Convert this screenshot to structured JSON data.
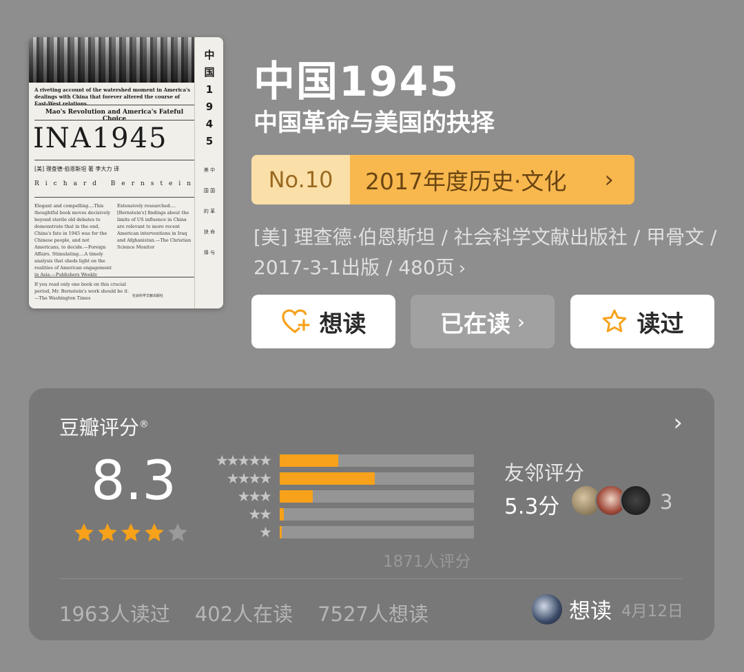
{
  "cover": {
    "side_title": "中\n国\n1\n9\n4\n5",
    "side_small": "美 中\n国 国\n的 革\n抉 命\n择 与",
    "tagline": "A riveting account of the watershed moment in America's dealings with China that forever altered the course of East-West relations.",
    "subtitle": "Mao's Revolution and America's Fateful Choice",
    "big_title": "INA1945",
    "credit": "[美] 理查德·伯恩斯坦 著    李大力 译",
    "author": "Richard Bernstein",
    "quote_left": "Elegant and compelling....This thoughtful book moves decisively beyond sterile old debates to demonstrate that in the end, China's fate in 1945 was for the Chinese people, and not Americans, to decide.—Foreign Affairs. Stimulating....A timely analysis that sheds light on the realities of American engagement in Asia.—Publishers Weekly",
    "quote_right": "Extensively researched....[Bernstein's] findings about the limits of US influence in China are relevant to more recent American interventions in Iraq and Afghanistan.—The Christian Science Monitor",
    "quote_bottom": "If you read only one book on this crucial period, Mr. Bernstein's work should be it.—The Washington Times",
    "publisher": "社会科学文献出版社"
  },
  "book": {
    "title": "中国1945",
    "subtitle": "中国革命与美国的抉择",
    "meta": "[美] 理查德·伯恩斯坦 / 社会科学文献出版社 / 甲骨文 / 2017-3-1出版 / 480页"
  },
  "rank": {
    "number": "No.10",
    "list_name": "2017年度历史·文化"
  },
  "actions": {
    "want": "想读",
    "reading": "已在读",
    "read": "读过"
  },
  "rating": {
    "title": "豆瓣评分",
    "registered_mark": "®",
    "score": "8.3",
    "stars": 4,
    "histogram": [
      {
        "stars": 5,
        "label": "★★★★★",
        "fraction": 0.3
      },
      {
        "stars": 4,
        "label": "★★★★",
        "fraction": 0.49
      },
      {
        "stars": 3,
        "label": "★★★",
        "fraction": 0.17
      },
      {
        "stars": 2,
        "label": "★★",
        "fraction": 0.02
      },
      {
        "stars": 1,
        "label": "★",
        "fraction": 0.01
      }
    ],
    "count_text": "1871人评分",
    "friends_title": "友邻评分",
    "friends_score": "5.3分",
    "friends_count": "3",
    "stats": {
      "read": "1963人读过",
      "reading": "402人在读",
      "want": "7527人想读"
    },
    "my_status": "想读",
    "my_status_date": "4月12日"
  },
  "colors": {
    "accent": "#f7a21a",
    "rank_bg": "#f8b84e",
    "rank_no_bg": "#fbdfa8",
    "background": "#8e8e8e",
    "card": "#787878"
  }
}
